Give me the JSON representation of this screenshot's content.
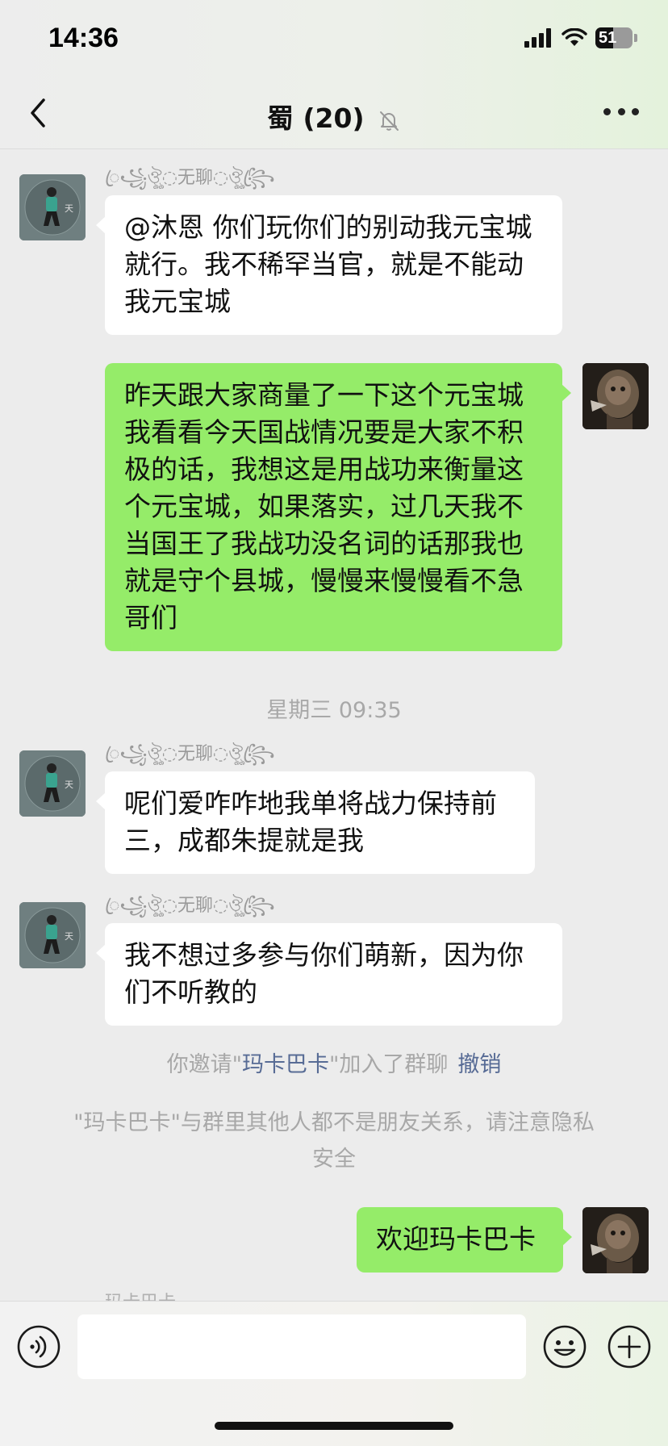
{
  "status_bar": {
    "time": "14:36",
    "battery_level": "51"
  },
  "header": {
    "title": "蜀 (20)"
  },
  "messages": [
    {
      "sender": "ꦿ꧁ঔৣ◌无聊◌ঔৣ꧂ꦿ",
      "text": "@沐恩 你们玩你们的别动我元宝城就行。我不稀罕当官，就是不能动我元宝城"
    },
    {
      "text": "昨天跟大家商量了一下这个元宝城我看看今天国战情况要是大家不积极的话，我想这是用战功来衡量这个元宝城，如果落实，过几天我不当国王了我战功没名词的话那我也就是守个县城，慢慢来慢慢看不急哥们"
    },
    {
      "sender": "ꦿ꧁ঔৣ◌无聊◌ঔৣ꧂ꦿ",
      "text": "呢们爱咋咋地我单将战力保持前三，成都朱提就是我"
    },
    {
      "sender": "ꦿ꧁ঔৣ◌无聊◌ঔৣ꧂ꦿ",
      "text": "我不想过多参与你们萌新，因为你们不听教的"
    },
    {
      "text": "欢迎玛卡巴卡"
    }
  ],
  "timestamp": "星期三 09:35",
  "system": {
    "invite_prefix": "你邀请\"",
    "invite_name": "玛卡巴卡",
    "invite_suffix": "\"加入了群聊",
    "revoke_label": "撤销",
    "privacy_line1": "\"玛卡巴卡\"与群里其他人都不是朋友关系，请注意隐私",
    "privacy_line2": "安全"
  },
  "next_sender_partial": "玛卡巴卡",
  "icons": {
    "back": "chevron-left-icon",
    "mute": "bell-off-icon",
    "more": "ellipsis-icon",
    "voice": "voice-icon",
    "emoji": "smiley-icon",
    "plus": "plus-icon"
  },
  "colors": {
    "outgoing_bubble": "#95ec69",
    "incoming_bubble": "#ffffff",
    "link": "#576b95",
    "background": "#ececec"
  }
}
